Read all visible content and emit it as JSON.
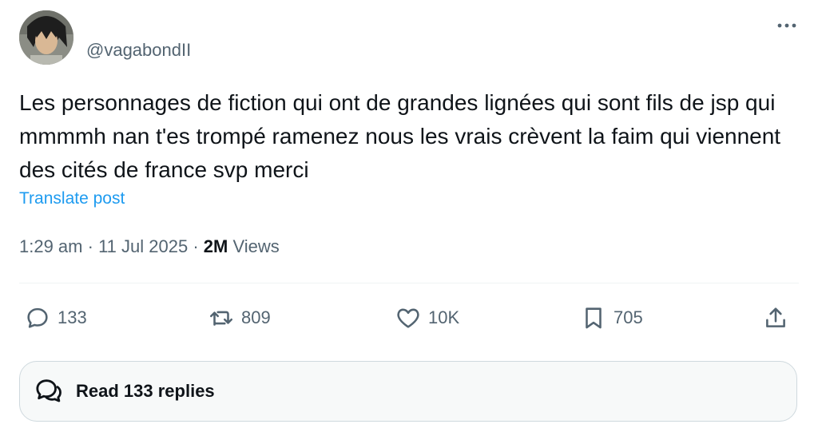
{
  "author": {
    "handle": "@vagabondII"
  },
  "post": {
    "text": "Les personnages de fiction qui ont de grandes lignées qui sont fils de jsp qui mmmmh nan t'es trompé ramenez nous les vrais crèvent la faim qui viennent des cités de france svp merci",
    "translate_label": "Translate post",
    "time": "1:29 am",
    "date": "11 Jul 2025",
    "separator": "·",
    "views_count": "2M",
    "views_label": "Views"
  },
  "actions": {
    "replies": "133",
    "reposts": "809",
    "likes": "10K",
    "bookmarks": "705"
  },
  "read_replies_label": "Read 133 replies",
  "colors": {
    "link": "#1d9bf0",
    "secondary_text": "#536471",
    "primary_text": "#0f1419"
  },
  "icons": [
    "more-icon",
    "reply-icon",
    "repost-icon",
    "like-icon",
    "bookmark-icon",
    "share-icon",
    "replies-bubble-icon"
  ]
}
